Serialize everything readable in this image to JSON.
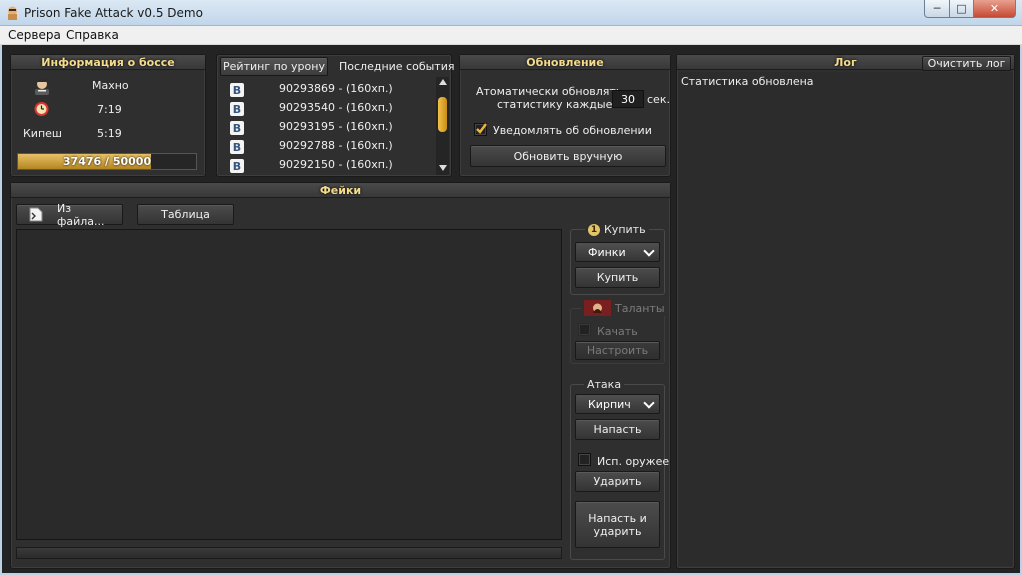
{
  "window": {
    "title": "Prison Fake Attack v0.5 Demo"
  },
  "menu": [
    {
      "label": "Сервера"
    },
    {
      "label": "Справка"
    }
  ],
  "boss": {
    "header": "Информация о боссе",
    "name": "Махно",
    "time": "7:19",
    "kipesh_label": "Кипеш",
    "kipesh_time": "5:19",
    "hp_text": "37476 / 50000",
    "hp_current": 37476,
    "hp_max": 50000
  },
  "rating": {
    "tabs": [
      {
        "label": "Рейтинг по урону"
      },
      {
        "label": "Последние события"
      }
    ],
    "vk_glyph": "B",
    "rows": [
      {
        "text": "90293869 - (160хп.)"
      },
      {
        "text": "90293540 - (160хп.)"
      },
      {
        "text": "90293195 - (160хп.)"
      },
      {
        "text": "90292788 - (160хп.)"
      },
      {
        "text": "90292150 - (160хп.)"
      }
    ]
  },
  "update": {
    "header": "Обновление",
    "auto_label_line1": "Атоматически обновлять",
    "auto_label_line2": "статистику каждые:",
    "interval_value": "30",
    "interval_unit": "сек.",
    "notify_label": "Уведомлять об обновлении",
    "notify_checked": true,
    "manual_button": "Обновить вручную"
  },
  "log": {
    "header": "Лог",
    "clear_button": "Очистить лог",
    "lines": [
      "Статистика обновлена"
    ]
  },
  "fakes": {
    "header": "Фейки",
    "from_file_button": "Из файла...",
    "table_button": "Таблица"
  },
  "buy": {
    "label": "Купить",
    "coin_glyph": "1",
    "select_value": "Финки",
    "button": "Купить"
  },
  "talents": {
    "label": "Таланты",
    "checkbox_label": "Качать",
    "button": "Настроить"
  },
  "attack": {
    "label": "Атака",
    "select_value": "Кирпич",
    "attack_button": "Напасть",
    "weapon_label": "Исп. оружее",
    "hit_button": "Ударить",
    "combo_button_line1": "Напасть и",
    "combo_button_line2": "ударить"
  },
  "colors": {
    "panel_header_text": "#f4dc8c",
    "hp_bar": "#d2a63a",
    "background": "#232323"
  }
}
